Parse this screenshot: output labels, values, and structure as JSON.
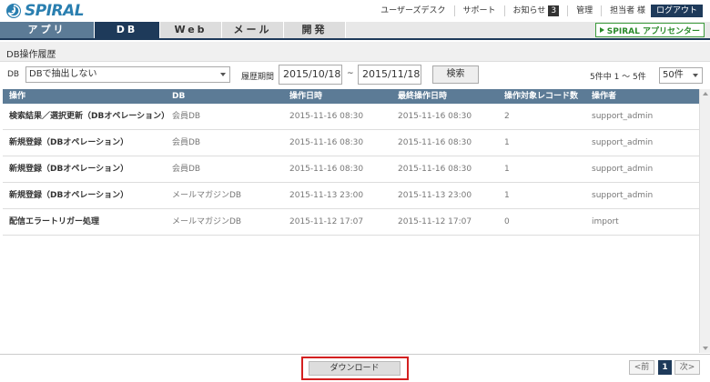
{
  "brand": {
    "name": "SPIRAL",
    "accent": "#2a7fb0",
    "nav_dark": "#1e3a5a"
  },
  "topbar": {
    "links": [
      "ユーザーズデスク",
      "サポート",
      "お知らせ"
    ],
    "notice_count": "3",
    "admin": "管理",
    "user": "担当者 様",
    "logout": "ログアウト"
  },
  "nav": {
    "tabs": [
      "アプリ",
      "DB",
      "Web",
      "メール",
      "開発"
    ],
    "active": "DB",
    "appcenter": "SPIRAL アプリセンター"
  },
  "page": {
    "title": "DB操作履歴"
  },
  "filter": {
    "db_label": "DB",
    "db_value": "DBで抽出しない",
    "period_label": "履歴期間",
    "date_from": "2015/10/18",
    "tilde": "~",
    "date_to": "2015/11/18",
    "search": "検索",
    "count": "5件中 1 ～ 5件",
    "per_page": "50件"
  },
  "table": {
    "headers": [
      "操作",
      "DB",
      "操作日時",
      "最終操作日時",
      "操作対象レコード数",
      "操作者"
    ],
    "rows": [
      [
        "検索結果／選択更新（DBオペレーション）",
        "会員DB",
        "2015-11-16 08:30",
        "2015-11-16 08:30",
        "2",
        "support_admin"
      ],
      [
        "新規登録（DBオペレーション）",
        "会員DB",
        "2015-11-16 08:30",
        "2015-11-16 08:30",
        "1",
        "support_admin"
      ],
      [
        "新規登録（DBオペレーション）",
        "会員DB",
        "2015-11-16 08:30",
        "2015-11-16 08:30",
        "1",
        "support_admin"
      ],
      [
        "新規登録（DBオペレーション）",
        "メールマガジンDB",
        "2015-11-13 23:00",
        "2015-11-13 23:00",
        "1",
        "support_admin"
      ],
      [
        "配信エラートリガー処理",
        "メールマガジンDB",
        "2015-11-12 17:07",
        "2015-11-12 17:07",
        "0",
        "import"
      ]
    ]
  },
  "footer": {
    "download": "ダウンロード",
    "prev": "<前",
    "page": "1",
    "next": "次>"
  }
}
